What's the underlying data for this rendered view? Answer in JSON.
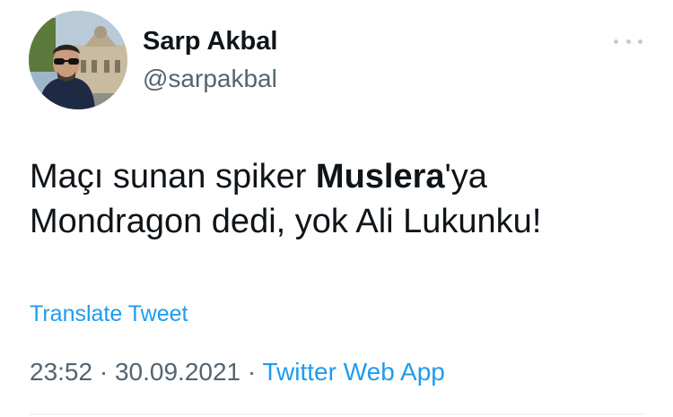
{
  "author": {
    "display_name": "Sarp Akbal",
    "handle": "@sarpakbal"
  },
  "more_icon": "more-horizontal-icon",
  "tweet": {
    "text_before": "Maçı sunan spiker ",
    "text_bold": "Muslera",
    "text_after": "'ya Mondragon dedi, yok Ali Lukunku!"
  },
  "translate_label": "Translate Tweet",
  "meta": {
    "time": "23:52",
    "separator1": " · ",
    "date": "30.09.2021",
    "separator2": " · ",
    "source": "Twitter Web App"
  },
  "colors": {
    "link": "#1d9bf0",
    "secondary_text": "#536471",
    "primary_text": "#0f1419"
  }
}
